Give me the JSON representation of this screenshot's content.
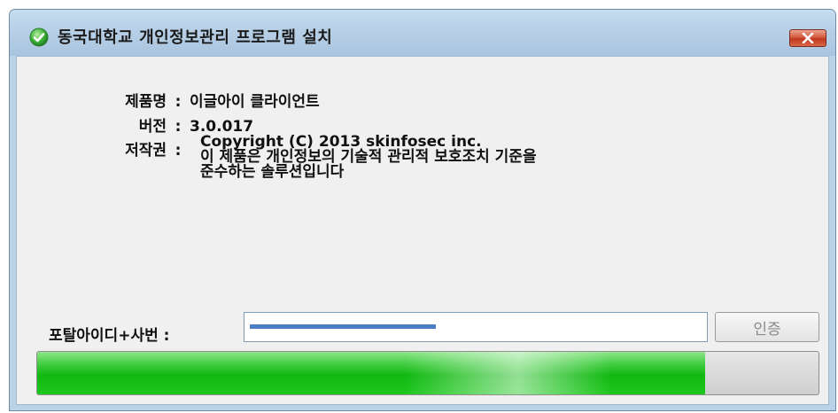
{
  "window": {
    "title": "동국대학교 개인정보관리 프로그램 설치"
  },
  "info": {
    "product_label": "제품명",
    "product_value": "이글아이 클라이언트",
    "version_label": "버전",
    "version_value": "3.0.017",
    "copyright_label": "저작권",
    "copyright_lines": [
      "Copyright (C) 2013 skinfosec inc.",
      "이 제품은 개인정보의 기술적 관리적 보호조치 기준을",
      "준수하는 솔루션입니다"
    ],
    "separator": ":"
  },
  "login": {
    "id_label": "포탈아이디+사번 :",
    "id_value": "",
    "auth_button": "인증"
  },
  "progress": {
    "fraction": 0.855
  },
  "icons": {
    "title": "check-circle-icon",
    "close": "close-icon"
  },
  "colors": {
    "titlebar": "#b6cfe6",
    "progress_green": "#10b810",
    "close_red": "#c0391c",
    "redaction_blue": "#4a7fc4"
  }
}
